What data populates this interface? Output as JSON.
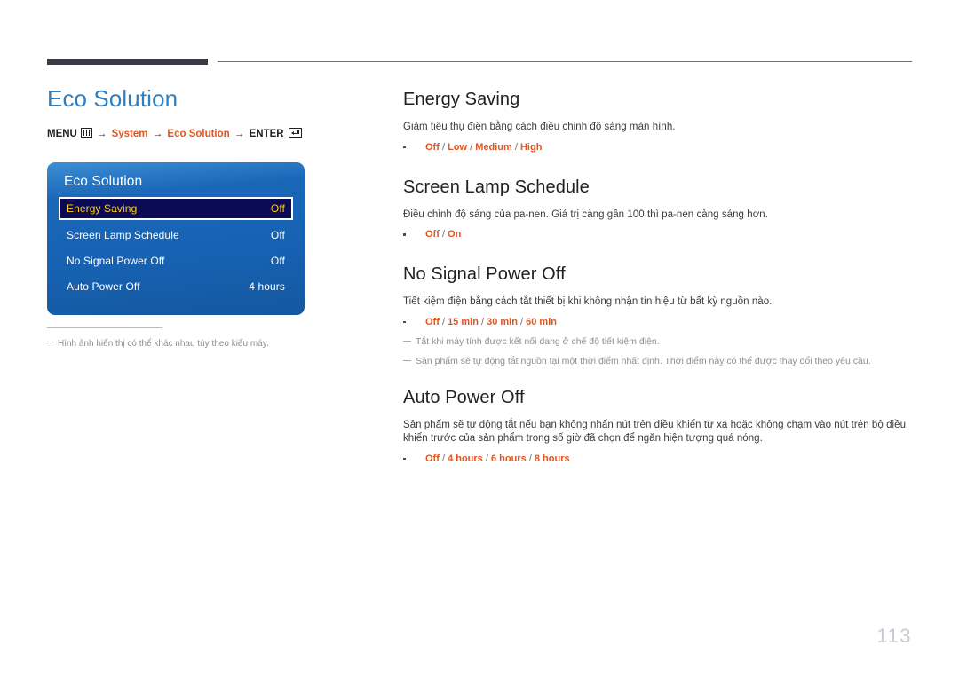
{
  "page": {
    "number": "113"
  },
  "header": {
    "title": "Eco Solution",
    "breadcrumb": {
      "menu_label": "MENU",
      "menu_icon": "menu-bars-icon",
      "arrow": "→",
      "step1": "System",
      "step2": "Eco Solution",
      "enter_label": "ENTER",
      "enter_icon": "enter-arrow-icon"
    }
  },
  "osd": {
    "title": "Eco Solution",
    "rows": [
      {
        "label": "Energy Saving",
        "value": "Off",
        "selected": true
      },
      {
        "label": "Screen Lamp Schedule",
        "value": "Off",
        "selected": false
      },
      {
        "label": "No Signal Power Off",
        "value": "Off",
        "selected": false
      },
      {
        "label": "Auto Power Off",
        "value": "4 hours",
        "selected": false
      }
    ]
  },
  "left_note": "Hình ảnh hiển thị có thể khác nhau tùy theo kiểu máy.",
  "sections": [
    {
      "title": "Energy Saving",
      "body": "Giảm tiêu thụ điện bằng cách điều chỉnh độ sáng màn hình.",
      "options": "Off / Low / Medium / High",
      "notes": []
    },
    {
      "title": "Screen Lamp Schedule",
      "body": "Điều chỉnh độ sáng của pa-nen. Giá trị càng gần 100 thì pa-nen càng sáng hơn.",
      "options": "Off / On",
      "notes": []
    },
    {
      "title": "No Signal Power Off",
      "body": "Tiết kiệm điện bằng cách tắt thiết bị khi không nhận tín hiệu từ bất kỳ nguồn nào.",
      "options": "Off / 15 min / 30 min / 60 min",
      "notes": [
        "Tắt khi máy tính được kết nối đang ở chế độ tiết kiệm điện.",
        "Sản phẩm sẽ tự động tắt nguồn tại một thời điểm nhất định. Thời điểm này có thể được thay đổi theo yêu cầu."
      ]
    },
    {
      "title": "Auto Power Off",
      "body": "Sản phẩm sẽ tự động tắt nếu bạn không nhấn nút trên điều khiển từ xa hoặc không chạm vào nút trên bộ điều khiển trước của sản phẩm trong số giờ đã chọn để ngăn hiện tượng quá nóng.",
      "options": "Off / 4 hours / 6 hours / 8 hours",
      "notes": []
    }
  ],
  "colors": {
    "title_blue": "#2e7fc1",
    "accent_orange": "#e2551f",
    "osd_blue": "#1a67b8",
    "osd_selected_bg": "#0a0b54",
    "osd_selected_text": "#fdd017",
    "note_gray": "#8d8d93",
    "page_number_gray": "#c9c9d2"
  }
}
